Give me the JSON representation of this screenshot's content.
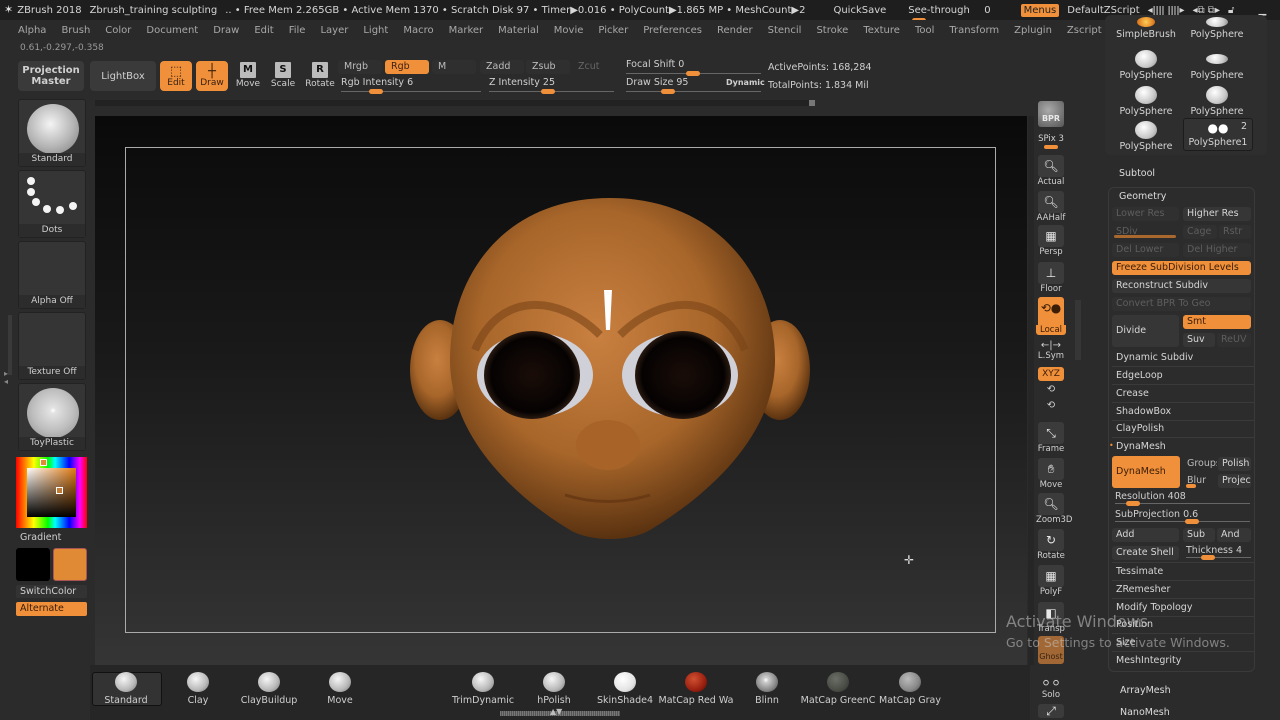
{
  "titlebar": {
    "app": "ZBrush 2018",
    "document": "Zbrush_training sculpting",
    "stats": "..  • Free Mem 2.265GB • Active Mem 1370 • Scratch Disk 97 •  Timer▶0.016 • PolyCount▶1.865 MP  • MeshCount▶2",
    "quicksave": "QuickSave",
    "see_through_label": "See-through",
    "see_through_value": "0",
    "menus": "Menus",
    "script": "DefaultZScript"
  },
  "menubar": [
    "Alpha",
    "Brush",
    "Color",
    "Document",
    "Draw",
    "Edit",
    "File",
    "Layer",
    "Light",
    "Macro",
    "Marker",
    "Material",
    "Movie",
    "Picker",
    "Preferences",
    "Render",
    "Stencil",
    "Stroke",
    "Texture",
    "Tool",
    "Transform",
    "Zplugin",
    "Zscript"
  ],
  "coords": "0.61,-0.297,-0.358",
  "toolbar": {
    "projection_master": "Projection Master",
    "lightbox": "LightBox",
    "edit": "Edit",
    "draw": "Draw",
    "move": "Move",
    "scale": "Scale",
    "rotate": "Rotate",
    "move_key": "M",
    "scale_key": "S",
    "rotate_key": "R",
    "mrgb": "Mrgb",
    "rgb": "Rgb",
    "m": "M",
    "zadd": "Zadd",
    "zsub": "Zsub",
    "zcut": "Zcut",
    "rgb_intensity_label": "Rgb Intensity",
    "rgb_intensity": "6",
    "z_intensity_label": "Z Intensity",
    "z_intensity": "25",
    "focal_shift_label": "Focal Shift",
    "focal_shift": "0",
    "draw_size_label": "Draw Size",
    "draw_size": "95",
    "dynamic": "Dynamic",
    "active_points": "ActivePoints: 168,284",
    "total_points": "TotalPoints: 1.834 Mil"
  },
  "left_shelf": {
    "brush": "Standard",
    "stroke": "Dots",
    "alpha": "Alpha Off",
    "texture": "Texture Off",
    "material": "ToyPlastic",
    "gradient": "Gradient",
    "switch_color": "SwitchColor",
    "alternate": "Alternate",
    "main_color": "#e08a36",
    "secondary_color": "#000000"
  },
  "right_shelf": [
    "BPR",
    "SPix 3",
    "Actual",
    "AAHalf",
    "Persp",
    "Floor",
    "Local",
    "L.Sym",
    "XYZ",
    "Frame",
    "Move",
    "Zoom3D",
    "Rotate",
    "PolyF",
    "Transp",
    "Ghost",
    "Solo"
  ],
  "tool_thumbs": [
    {
      "label": "SimpleBrush"
    },
    {
      "label": "PolySphere"
    },
    {
      "label": "PolySphere"
    },
    {
      "label": "PolySphere"
    },
    {
      "label": "PolySphere"
    },
    {
      "label": "PolySphere"
    },
    {
      "label": "PolySphere"
    },
    {
      "label": "PolySphere1",
      "count": "2"
    }
  ],
  "subtool": "Subtool",
  "geometry": {
    "title": "Geometry",
    "lower_res": "Lower Res",
    "higher_res": "Higher Res",
    "sdiv": "SDiv",
    "cage": "Cage",
    "rstr": "Rstr",
    "del_lower": "Del Lower",
    "del_higher": "Del Higher",
    "freeze": "Freeze SubDivision Levels",
    "reconstruct": "Reconstruct Subdiv",
    "convert_bpr": "Convert BPR To Geo",
    "divide": "Divide",
    "smt": "Smt",
    "suv": "Suv",
    "reuv": "ReUV",
    "items": [
      "Dynamic Subdiv",
      "EdgeLoop",
      "Crease",
      "ShadowBox",
      "ClayPolish"
    ],
    "dynamesh_header": "DynaMesh",
    "dynamesh_btn": "DynaMesh",
    "groups": "Groups",
    "polish": "Polish",
    "blur": "Blur",
    "project": "Project",
    "resolution_label": "Resolution",
    "resolution": "408",
    "subprojection_label": "SubProjection",
    "subprojection": "0.6",
    "add": "Add",
    "sub": "Sub",
    "and": "And",
    "create_shell": "Create Shell",
    "thickness_label": "Thickness",
    "thickness": "4",
    "items2": [
      "Tessimate",
      "ZRemesher",
      "Modify Topology",
      "Position",
      "Size",
      "MeshIntegrity"
    ]
  },
  "panel_below": [
    "ArrayMesh",
    "NanoMesh"
  ],
  "bottom_shelf": [
    {
      "label": "Standard",
      "kind": "brush"
    },
    {
      "label": "Clay",
      "kind": "brush"
    },
    {
      "label": "ClayBuildup",
      "kind": "brush"
    },
    {
      "label": "Move",
      "kind": "brush"
    },
    {
      "label": "TrimDynamic",
      "kind": "brush"
    },
    {
      "label": "hPolish",
      "kind": "brush"
    },
    {
      "label": "SkinShade4",
      "kind": "material"
    },
    {
      "label": "MatCap Red Wa",
      "kind": "material"
    },
    {
      "label": "Blinn",
      "kind": "material"
    },
    {
      "label": "MatCap GreenC",
      "kind": "material"
    },
    {
      "label": "MatCap Gray",
      "kind": "material"
    }
  ],
  "watermark": {
    "line1": "Activate Windows",
    "line2": "Go to Settings to activate Windows."
  },
  "colors": {
    "accent": "#f0903a",
    "skin": "#b5702e"
  }
}
